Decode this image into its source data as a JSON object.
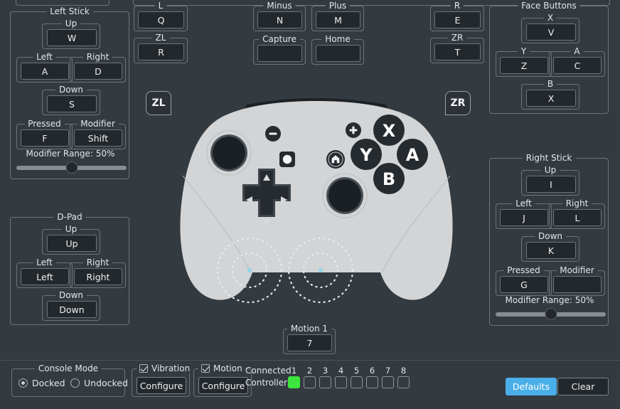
{
  "groups": {
    "left_stick": "Left Stick",
    "d_pad": "D-Pad",
    "face_buttons": "Face Buttons",
    "right_stick": "Right Stick",
    "console_mode": "Console Mode",
    "l": "L",
    "zl": "ZL",
    "r": "R",
    "zr": "ZR",
    "minus": "Minus",
    "plus": "Plus",
    "capture": "Capture",
    "home": "Home",
    "motion1": "Motion 1",
    "x": "X",
    "y": "Y",
    "a": "A",
    "b": "B",
    "up": "Up",
    "down": "Down",
    "left": "Left",
    "right": "Right",
    "pressed": "Pressed",
    "modifier": "Modifier"
  },
  "left_stick": {
    "up": "W",
    "left": "A",
    "right": "D",
    "down": "S",
    "pressed": "F",
    "modifier": "Shift",
    "range_label": "Modifier Range: 50%",
    "range_value": 50
  },
  "right_stick": {
    "up": "I",
    "left": "J",
    "right": "L",
    "down": "K",
    "pressed": "G",
    "modifier": "",
    "range_label": "Modifier Range: 50%",
    "range_value": 50
  },
  "d_pad": {
    "up": "Up",
    "left": "Left",
    "right": "Right",
    "down": "Down"
  },
  "face_buttons": {
    "x": "V",
    "y": "Z",
    "a": "C",
    "b": "X"
  },
  "shoulders": {
    "l": "Q",
    "zl": "R",
    "r": "E",
    "zr": "T"
  },
  "system": {
    "minus": "N",
    "plus": "M",
    "capture": "",
    "home": ""
  },
  "motion": {
    "motion1": "7"
  },
  "triggers": {
    "zl_chip": "ZL",
    "zr_chip": "ZR"
  },
  "bottom": {
    "docked": "Docked",
    "undocked": "Undocked",
    "docked_selected": true,
    "vibration_label": "Vibration",
    "vibration_checked": true,
    "vibration_configure": "Configure",
    "motion_label": "Motion",
    "motion_checked": true,
    "motion_configure": "Configure",
    "connected_line1": "Connected",
    "connected_line2": "Controllers",
    "controller_numbers": [
      "1",
      "2",
      "3",
      "4",
      "5",
      "6",
      "7",
      "8"
    ],
    "controller_states": [
      true,
      false,
      false,
      false,
      false,
      false,
      false,
      false
    ],
    "defaults": "Defaults",
    "clear": "Clear"
  },
  "controller_art": {
    "minus_icon": "minus-button",
    "plus_icon": "plus-button",
    "capture_icon": "capture-button",
    "home_icon": "home-button",
    "face_x": "X",
    "face_y": "Y",
    "face_a": "A",
    "face_b": "B"
  },
  "colors": {
    "background": "#333a40",
    "accent": "#4aaee8",
    "connected": "#3ce63c",
    "body": "#d2d4d5",
    "dark": "#2e343a",
    "stick_dot": "#8fd7e8"
  }
}
